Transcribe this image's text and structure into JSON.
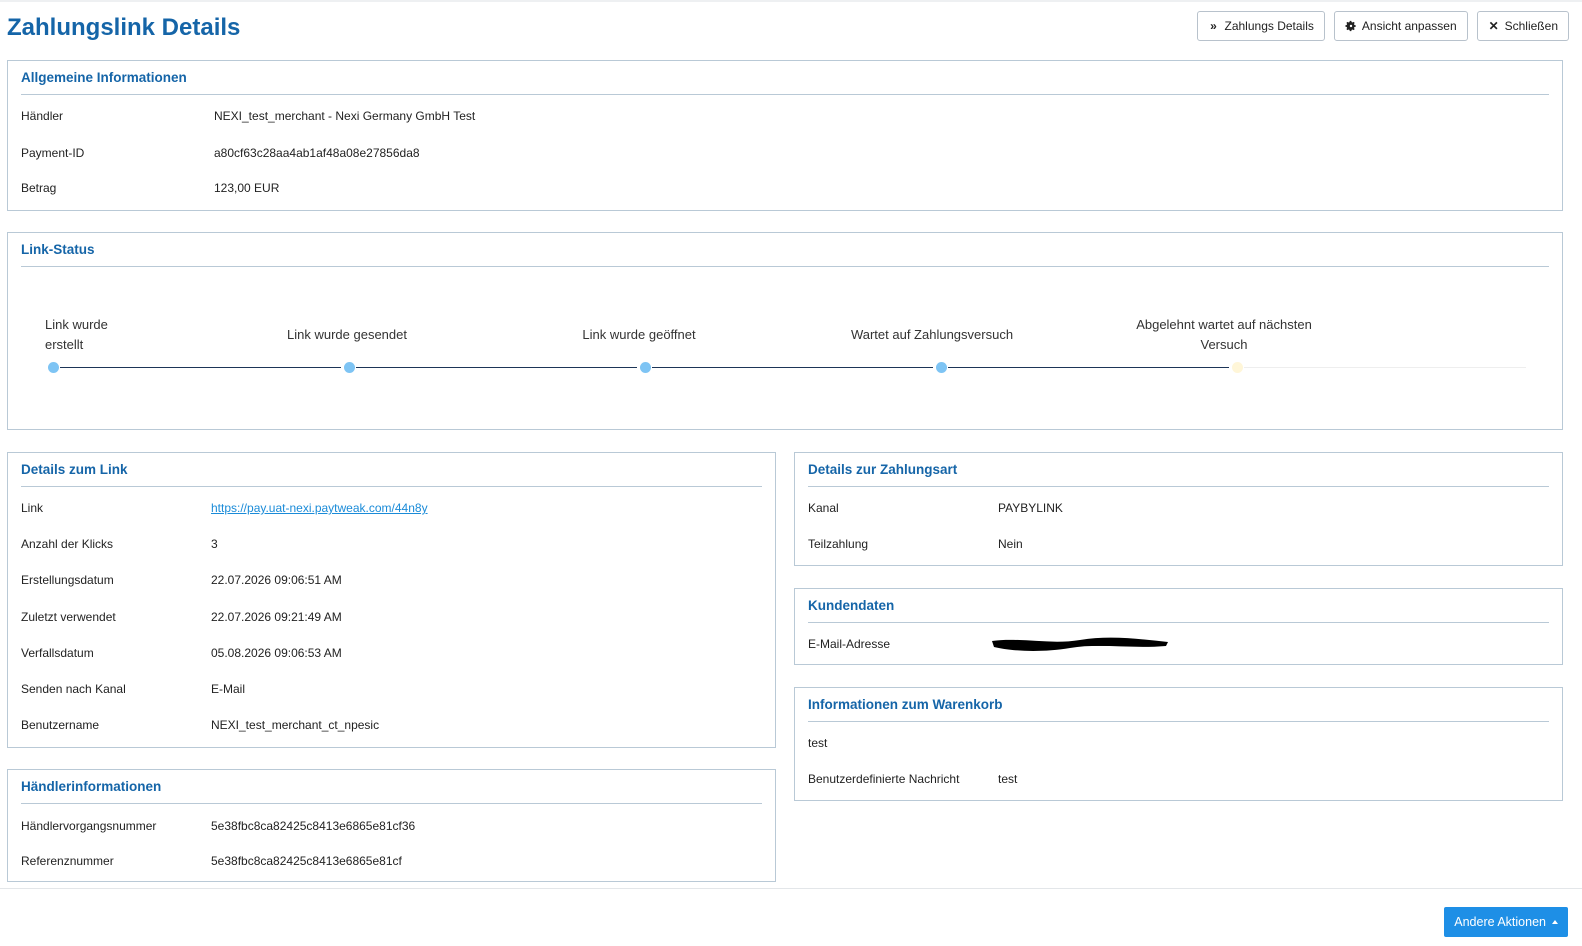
{
  "page": {
    "title": "Zahlungslink Details"
  },
  "header_buttons": {
    "payment_details": "Zahlungs Details",
    "customize_view": "Ansicht anpassen",
    "close": "Schließen"
  },
  "general": {
    "title": "Allgemeine Informationen",
    "rows": [
      {
        "label": "Händler",
        "value": "NEXI_test_merchant - Nexi Germany GmbH Test"
      },
      {
        "label": "Payment-ID",
        "value": "a80cf63c28aa4ab1af48a08e27856da8"
      },
      {
        "label": "Betrag",
        "value": "123,00 EUR"
      }
    ]
  },
  "link_status": {
    "title": "Link-Status",
    "steps": [
      {
        "label_line1": "Link wurde",
        "label_line2": "erstellt",
        "state": "done"
      },
      {
        "label_line1": "Link wurde gesendet",
        "label_line2": "",
        "state": "done"
      },
      {
        "label_line1": "Link wurde geöffnet",
        "label_line2": "",
        "state": "done"
      },
      {
        "label_line1": "Wartet auf Zahlungsversuch",
        "label_line2": "",
        "state": "done"
      },
      {
        "label_line1": "Abgelehnt wartet auf nächsten",
        "label_line2": "Versuch",
        "state": "current"
      }
    ]
  },
  "link_details": {
    "title": "Details zum Link",
    "rows": [
      {
        "label": "Link",
        "value": "https://pay.uat-nexi.paytweak.com/44n8y"
      },
      {
        "label": "Anzahl der Klicks",
        "value": "3"
      },
      {
        "label": "Erstellungsdatum",
        "value": "22.07.2026 09:06:51 AM"
      },
      {
        "label": "Zuletzt verwendet",
        "value": "22.07.2026 09:21:49 AM"
      },
      {
        "label": "Verfallsdatum",
        "value": "05.08.2026 09:06:53 AM"
      },
      {
        "label": "Senden nach Kanal",
        "value": "E-Mail"
      },
      {
        "label": "Benutzername",
        "value": "NEXI_test_merchant_ct_npesic"
      }
    ]
  },
  "merchant_info": {
    "title": "Händlerinformationen",
    "rows": [
      {
        "label": "Händlervorgangsnummer",
        "value": "5e38fbc8ca82425c8413e6865e81cf36"
      },
      {
        "label": "Referenznummer",
        "value": "5e38fbc8ca82425c8413e6865e81cf"
      }
    ]
  },
  "payment_method": {
    "title": "Details zur Zahlungsart",
    "rows": [
      {
        "label": "Kanal",
        "value": "PAYBYLINK"
      },
      {
        "label": "Teilzahlung",
        "value": "Nein"
      }
    ]
  },
  "customer": {
    "title": "Kundendaten",
    "rows": [
      {
        "label": "E-Mail-Adresse",
        "value": ""
      }
    ]
  },
  "cart": {
    "title": "Informationen zum Warenkorb",
    "rows": [
      {
        "label": "test",
        "value": ""
      },
      {
        "label": "Benutzerdefinierte Nachricht",
        "value": "test"
      }
    ]
  },
  "footer": {
    "other_actions": "Andere Aktionen"
  },
  "colors": {
    "accent": "#1565a8",
    "primary_button": "#1e8fe6",
    "step_done": "#7ec4f4",
    "step_current": "#fff6d8",
    "link": "#1a8bd8"
  },
  "icons": {
    "payment_details": "double-chevron-right-icon",
    "customize_view": "gear-icon",
    "close": "close-icon",
    "other_actions": "caret-up-icon"
  }
}
